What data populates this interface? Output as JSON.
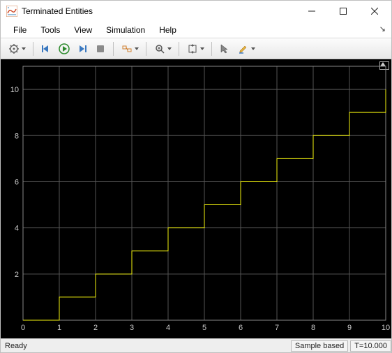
{
  "window": {
    "title": "Terminated Entities"
  },
  "menu": {
    "file": "File",
    "tools": "Tools",
    "view": "View",
    "simulation": "Simulation",
    "help": "Help"
  },
  "toolbar_icons": {
    "settings": "settings-icon",
    "step_back": "step-back-icon",
    "run": "run-icon",
    "step_fwd": "step-forward-icon",
    "stop": "stop-icon",
    "highlight": "highlight-signal-icon",
    "zoom": "zoom-icon",
    "autoscale": "autoscale-icon",
    "cursor": "cursor-measure-icon",
    "edit": "edit-icon"
  },
  "status": {
    "ready": "Ready",
    "mode": "Sample based",
    "time": "T=10.000"
  },
  "chart_data": {
    "type": "line",
    "step_mode": "post",
    "x": [
      0,
      1,
      2,
      3,
      4,
      5,
      6,
      7,
      8,
      9,
      10
    ],
    "y": [
      0,
      1,
      2,
      3,
      4,
      5,
      6,
      7,
      8,
      9,
      10
    ],
    "xlim": [
      0,
      10
    ],
    "ylim": [
      0,
      11
    ],
    "xticks": [
      0,
      1,
      2,
      3,
      4,
      5,
      6,
      7,
      8,
      9,
      10
    ],
    "yticks": [
      2,
      4,
      6,
      8,
      10
    ],
    "xlabel": "",
    "ylabel": "",
    "title": "",
    "grid": true,
    "line_color": "#f5f50e"
  }
}
